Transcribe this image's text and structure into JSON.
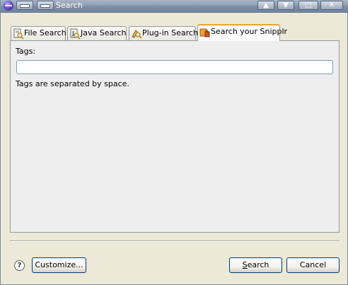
{
  "window": {
    "title": "Search"
  },
  "tabs": [
    {
      "label": "File Search",
      "icon": "file-search-icon",
      "active": false
    },
    {
      "label": "Java Search",
      "icon": "java-search-icon",
      "active": false
    },
    {
      "label": "Plug-in Search",
      "icon": "plugin-search-icon",
      "active": false
    },
    {
      "label": "Search your Snipplr",
      "icon": "snipplr-icon",
      "active": true
    }
  ],
  "form": {
    "tags_label": "Tags:",
    "tags_value": "",
    "hint": "Tags are separated by space."
  },
  "buttons": {
    "help": "?",
    "customize": "Customize...",
    "search_prefix": "S",
    "search_rest": "earch",
    "cancel": "Cancel"
  },
  "colors": {
    "titlebar": "#8d9db3",
    "active_tab_accent": "#e8a530",
    "dialog_bg": "#ece9d8",
    "panel_bg": "#eeeeee"
  }
}
